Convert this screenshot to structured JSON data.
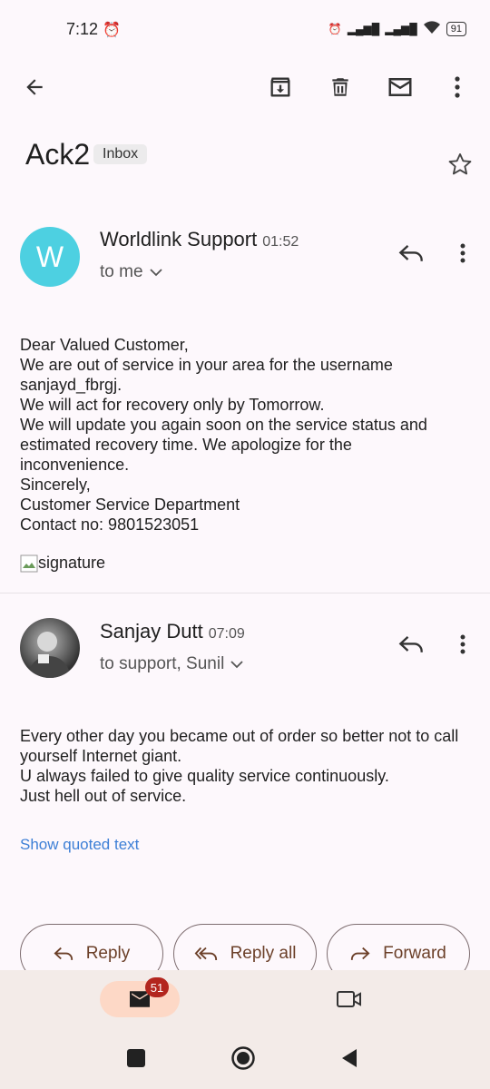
{
  "status_bar": {
    "time": "7:12",
    "battery": "91"
  },
  "email": {
    "subject": "Ack2",
    "label": "Inbox",
    "messages": [
      {
        "avatar_letter": "W",
        "sender": "Worldlink Support",
        "time": "01:52",
        "recipients": "to me",
        "body": "Dear Valued Customer,\nWe are out of service in your area for the username sanjayd_fbrgj.\nWe will act for recovery only by Tomorrow.\nWe will update you again soon on the service status and estimated recovery time. We apologize for the inconvenience.\nSincerely,\nCustomer Service Department\nContact no: 9801523051",
        "signature_alt": "signature"
      },
      {
        "sender": "Sanjay Dutt",
        "time": "07:09",
        "recipients": "to support, Sunil",
        "body": "Every other day you became out of order so better not to call yourself Internet giant.\nU always failed to give quality service continuously.\nJust hell out of service.",
        "show_quoted": "Show quoted text"
      }
    ]
  },
  "actions": {
    "reply": "Reply",
    "reply_all": "Reply all",
    "forward": "Forward"
  },
  "bottom_nav": {
    "mail_badge": "51"
  },
  "colors": {
    "accent": "#6b3f28",
    "avatar": "#4dd0e1",
    "badge": "#b3261e",
    "link": "#3d7fd6"
  }
}
